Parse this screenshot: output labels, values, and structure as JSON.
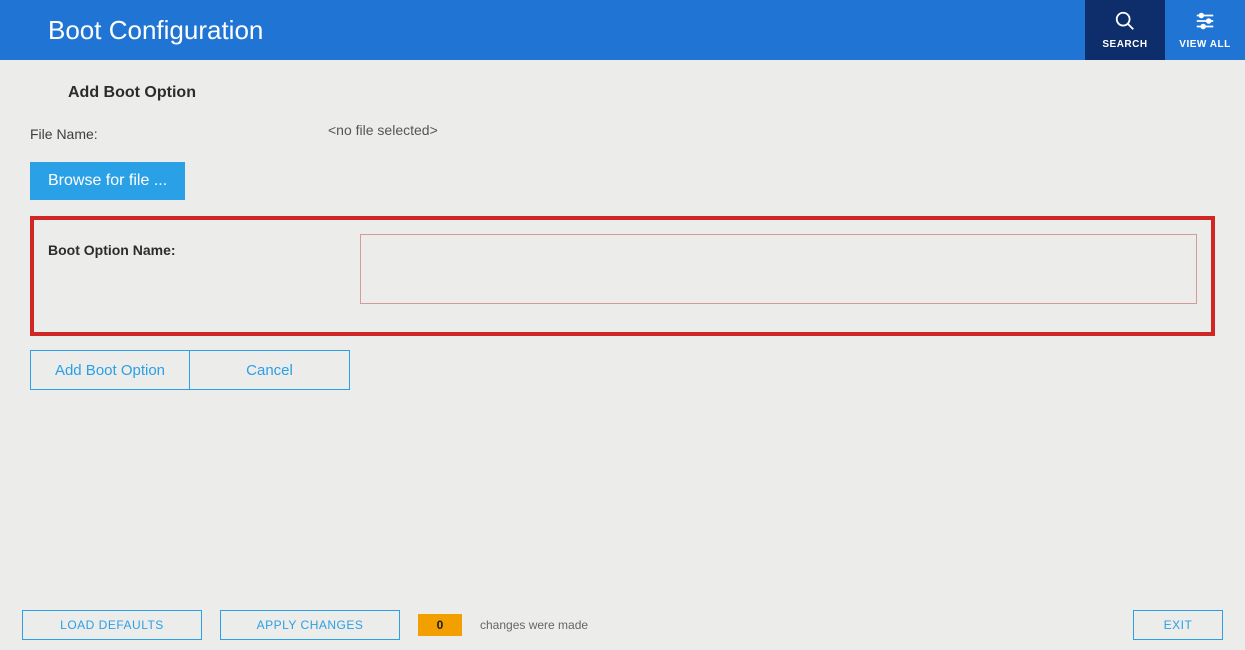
{
  "header": {
    "title": "Boot Configuration",
    "search_label": "SEARCH",
    "viewall_label": "VIEW ALL"
  },
  "section": {
    "heading": "Add Boot Option",
    "file_name_label": "File Name:",
    "file_name_value": "<no file selected>",
    "browse_label": "Browse for file ...",
    "boot_option_name_label": "Boot Option Name:",
    "boot_option_name_value": "",
    "add_label": "Add Boot Option",
    "cancel_label": "Cancel"
  },
  "footer": {
    "load_defaults": "LOAD DEFAULTS",
    "apply_changes": "APPLY CHANGES",
    "change_count": "0",
    "change_text": "changes were made",
    "exit": "EXIT"
  },
  "colors": {
    "primary": "#1f74d4",
    "primary_dark": "#0e2d6b",
    "accent": "#2aa0e6",
    "highlight_border": "#d12626",
    "badge": "#f2a000"
  }
}
